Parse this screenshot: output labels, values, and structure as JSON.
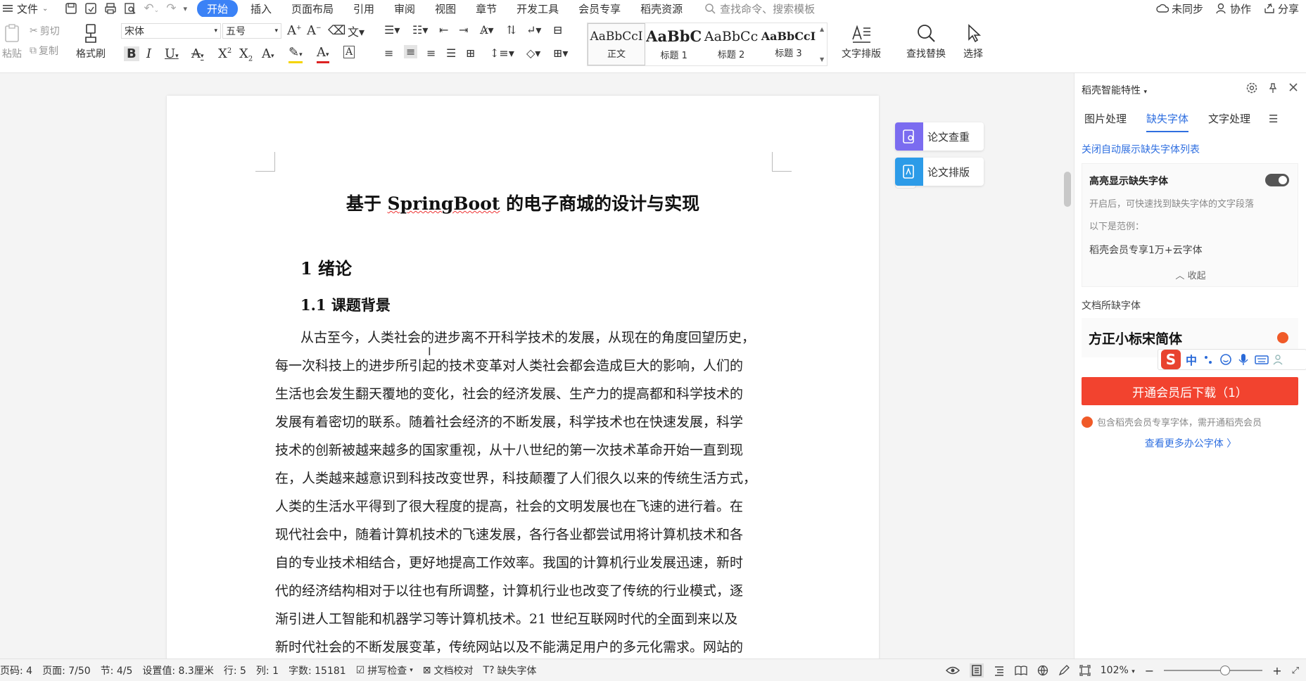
{
  "menubar": {
    "file": "文件",
    "tabs": [
      "开始",
      "插入",
      "页面布局",
      "引用",
      "审阅",
      "视图",
      "章节",
      "开发工具",
      "会员专享",
      "稻壳资源"
    ],
    "active_tab": "开始",
    "search_placeholder": "查找命令、搜索模板",
    "sync": "未同步",
    "collab": "协作",
    "share": "分享"
  },
  "ribbon": {
    "paste": "粘贴",
    "cut": "剪切",
    "copy": "复制",
    "format_painter": "格式刷",
    "font_name": "宋体",
    "font_size": "五号",
    "styles": [
      {
        "preview": "AaBbCcI",
        "label": "正文"
      },
      {
        "preview": "AaBbC",
        "label": "标题 1"
      },
      {
        "preview": "AaBbCc",
        "label": "标题 2"
      },
      {
        "preview": "AaBbCcI",
        "label": "标题 3"
      }
    ],
    "text_layout": "文字排版",
    "find_replace": "查找替换",
    "select": "选择"
  },
  "document": {
    "title_pre": "基于 ",
    "title_mark": "SpringBoot",
    "title_post": " 的电子商城的设计与实现",
    "h1": "1    绪论",
    "h2": "1.1    课题背景",
    "lines": [
      "从古至今，人类社会的进步离不开科学技术的发展，从现在的角度回望历史，",
      "每一次科技上的进步所引起的技术变革对人类社会都会造成巨大的影响，人们的",
      "生活也会发生翻天覆地的变化，社会的经济发展、生产力的提高都和科学技术的",
      "发展有着密切的联系。随着社会经济的不断发展，科学技术也在快速发展，科学",
      "技术的创新被越来越多的国家重视，从十八世纪的第一次技术革命开始一直到现",
      "在，人类越来越意识到科技改变世界，科技颠覆了人们很久以来的传统生活方式，",
      "人类的生活水平得到了很大程度的提高，社会的文明发展也在飞速的进行着。在",
      "现代社会中，随着计算机技术的飞速发展，各行各业都尝试用将计算机技术和各",
      "自的专业技术相结合，更好地提高工作效率。我国的计算机行业发展迅速，新时",
      "代的经济结构相对于以往也有所调整，计算机行业也改变了传统的行业模式，逐",
      "渐引进人工智能和机器学习等计算机技术。21 世纪互联网时代的全面到来以及",
      "新时代社会的不断发展变革，传统网站以及不能满足用户的多元化需求。网站的"
    ]
  },
  "floating": {
    "check": "论文查重",
    "layout": "论文排版"
  },
  "panel": {
    "title": "稻壳智能特性",
    "tabs": [
      "图片处理",
      "缺失字体",
      "文字处理"
    ],
    "active_tab": "缺失字体",
    "auto_link": "关闭自动展示缺失字体列表",
    "highlight_title": "高亮显示缺失字体",
    "highlight_desc": "开启后，可快速找到缺失字体的文字段落",
    "example_label": "以下是范例：",
    "example_text": "稻壳会员专享1万+云字体",
    "collapse": "收起",
    "section": "文档所缺字体",
    "missing_font": "方正小标宋简体",
    "ime_zh": "中",
    "download_btn": "开通会员后下载（1）",
    "note": "包含稻壳会员专享字体，需开通稻壳会员",
    "more": "查看更多办公字体 〉"
  },
  "status": {
    "page_code": "页码: 4",
    "page": "页面: 7/50",
    "section": "节: 4/5",
    "setting": "设置值: 8.3厘米",
    "row": "行: 5",
    "col": "列: 1",
    "words": "字数: 15181",
    "spell": "拼写检查",
    "proof": "文档校对",
    "missing": "缺失字体",
    "zoom": "102%"
  }
}
